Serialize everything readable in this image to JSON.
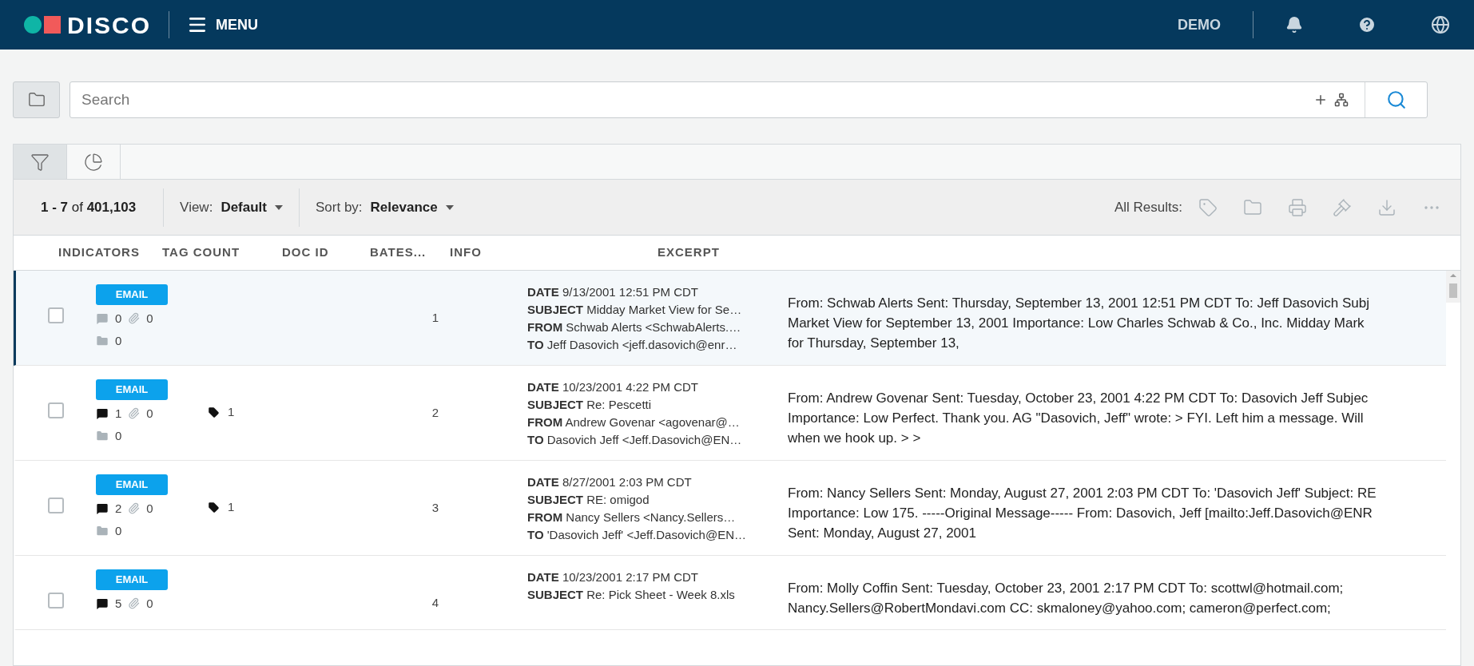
{
  "header": {
    "logo": "DISCO",
    "menu": "MENU",
    "user": "DEMO"
  },
  "search": {
    "placeholder": "Search"
  },
  "tabs": [
    {
      "kind": "filter",
      "selected": true
    },
    {
      "kind": "chart",
      "selected": false
    }
  ],
  "toolbar": {
    "count": "**1 - 7** of **401,103**",
    "view_label": "View:",
    "view_value": "Default",
    "sort_label": "Sort by:",
    "sort_value": "Relevance",
    "all_results": "All Results:"
  },
  "columns": [
    "INDICATORS",
    "TAG COUNT",
    "DOC ID",
    "BATES...",
    "INFO",
    "EXCERPT"
  ],
  "rows": [
    {
      "selected": true,
      "checked": false,
      "badge": "EMAIL",
      "comments": "0",
      "comments_active": false,
      "attachments": "0",
      "folders": "0",
      "bates": "1",
      "info": [
        {
          "label": "DATE",
          "value": "9/13/2001 12:51 PM CDT"
        },
        {
          "label": "SUBJECT",
          "value": "Midday Market View for Se…"
        },
        {
          "label": "FROM",
          "value": "Schwab Alerts <SchwabAlerts.…"
        },
        {
          "label": "TO",
          "value": "Jeff Dasovich <jeff.dasovich@enr…"
        }
      ],
      "excerpt": [
        "From: Schwab Alerts Sent: Thursday, September 13, 2001 12:51 PM CDT To: Jeff Dasovich Subj",
        "Market View for September 13, 2001 Importance: Low Charles Schwab & Co., Inc. Midday Mark",
        "for Thursday, September 13,"
      ]
    },
    {
      "selected": false,
      "checked": false,
      "badge": "EMAIL",
      "comments": "1",
      "comments_active": true,
      "attachments": "0",
      "folders": "0",
      "tag_count": "1",
      "bates": "2",
      "info": [
        {
          "label": "DATE",
          "value": "10/23/2001 4:22 PM CDT"
        },
        {
          "label": "SUBJECT",
          "value": "Re: Pescetti"
        },
        {
          "label": "FROM",
          "value": "Andrew Govenar <agovenar@…"
        },
        {
          "label": "TO",
          "value": "Dasovich Jeff <Jeff.Dasovich@EN…"
        }
      ],
      "excerpt": [
        "From: Andrew Govenar Sent: Tuesday, October 23, 2001 4:22 PM CDT To: Dasovich Jeff Subjec",
        "Importance: Low Perfect. Thank you. AG \"Dasovich, Jeff\" wrote: > FYI. Left him a message. Will",
        "when we hook up. > >"
      ]
    },
    {
      "selected": false,
      "checked": false,
      "badge": "EMAIL",
      "comments": "2",
      "comments_active": true,
      "attachments": "0",
      "folders": "0",
      "tag_count": "1",
      "bates": "3",
      "info": [
        {
          "label": "DATE",
          "value": "8/27/2001 2:03 PM CDT"
        },
        {
          "label": "SUBJECT",
          "value": "RE: omigod"
        },
        {
          "label": "FROM",
          "value": "Nancy Sellers <Nancy.Sellers…"
        },
        {
          "label": "TO",
          "value": "'Dasovich Jeff' <Jeff.Dasovich@EN…"
        }
      ],
      "excerpt": [
        "From: Nancy Sellers Sent: Monday, August 27, 2001 2:03 PM CDT To: 'Dasovich Jeff' Subject: RE",
        "Importance: Low 175. -----Original Message----- From: Dasovich, Jeff [mailto:Jeff.Dasovich@ENR",
        "Sent: Monday, August 27, 2001"
      ]
    },
    {
      "selected": false,
      "checked": false,
      "badge": "EMAIL",
      "comments": "5",
      "comments_active": true,
      "attachments": "0",
      "bates": "4",
      "info": [
        {
          "label": "DATE",
          "value": "10/23/2001 2:17 PM CDT"
        },
        {
          "label": "SUBJECT",
          "value": "Re: Pick Sheet - Week 8.xls"
        }
      ],
      "excerpt": [
        "From: Molly Coffin Sent: Tuesday, October 23, 2001 2:17 PM CDT To: scottwl@hotmail.com;",
        "Nancy.Sellers@RobertMondavi.com CC: skmaloney@yahoo.com; cameron@perfect.com;"
      ]
    }
  ]
}
